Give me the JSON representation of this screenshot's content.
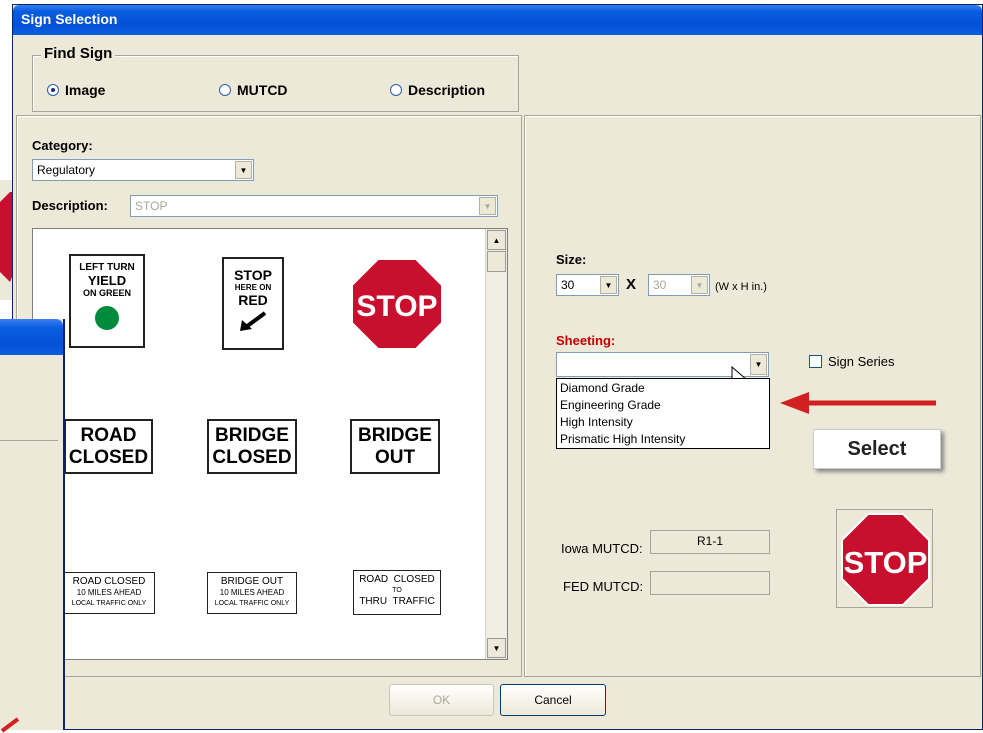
{
  "window": {
    "title": "Sign Selection"
  },
  "find_sign": {
    "title": "Find Sign",
    "options": [
      "Image",
      "MUTCD",
      "Description"
    ],
    "selected": "Image"
  },
  "category": {
    "label": "Category:",
    "value": "Regulatory"
  },
  "description": {
    "label": "Description:",
    "value": "STOP"
  },
  "signs": [
    {
      "lines": [
        "LEFT TURN",
        "YIELD",
        "ON GREEN"
      ],
      "kind": "left-turn-yield"
    },
    {
      "lines": [
        "STOP",
        "HERE ON",
        "RED"
      ],
      "kind": "stop-here-on-red"
    },
    {
      "lines": [
        "STOP"
      ],
      "kind": "stop-octagon"
    },
    {
      "lines": [
        "ROAD",
        "CLOSED"
      ],
      "kind": "road-closed"
    },
    {
      "lines": [
        "BRIDGE",
        "CLOSED"
      ],
      "kind": "bridge-closed"
    },
    {
      "lines": [
        "BRIDGE",
        "OUT"
      ],
      "kind": "bridge-out"
    },
    {
      "lines": [
        "ROAD CLOSED",
        "10 MILES AHEAD",
        "LOCAL TRAFFIC ONLY"
      ],
      "kind": "road-closed-ahead"
    },
    {
      "lines": [
        "BRIDGE OUT",
        "10 MILES AHEAD",
        "LOCAL TRAFFIC ONLY"
      ],
      "kind": "bridge-out-ahead"
    },
    {
      "lines": [
        "ROAD  CLOSED",
        "TO",
        "THRU  TRAFFIC"
      ],
      "kind": "road-closed-thru"
    }
  ],
  "size": {
    "label": "Size:",
    "width": "30",
    "height": "30",
    "times": "X",
    "unit": "(W x H in.)"
  },
  "sheeting": {
    "label": "Sheeting:",
    "value": "",
    "options": [
      "Diamond Grade",
      "Engineering Grade",
      "High Intensity",
      "Prismatic High Intensity"
    ]
  },
  "sign_series": {
    "label": "Sign Series",
    "checked": false
  },
  "callout": {
    "text": "Select"
  },
  "iowa_mutcd": {
    "label": "Iowa MUTCD:",
    "value": "R1-1"
  },
  "fed_mutcd": {
    "label": "FED MUTCD:",
    "value": ""
  },
  "preview": {
    "text": "STOP"
  },
  "buttons": {
    "ok": "OK",
    "cancel": "Cancel"
  },
  "colors": {
    "stop_red": "#c8102e",
    "arrow_red": "#d21f1f",
    "green": "#008a3e",
    "title_blue": "#0a5ee0",
    "sheeting_label": "#c00000"
  }
}
